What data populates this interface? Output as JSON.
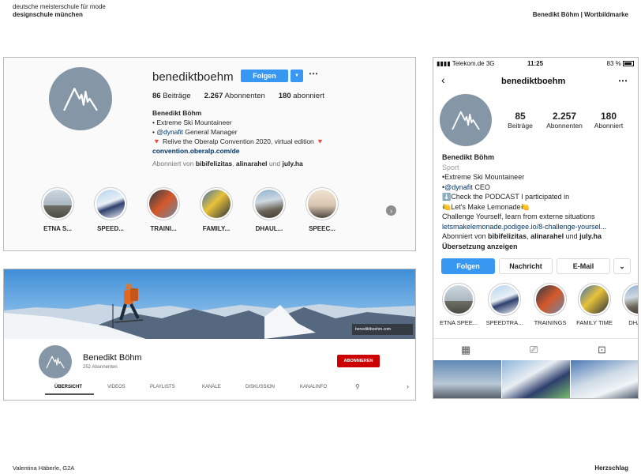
{
  "sheet": {
    "school_line1": "deutsche meisterschule für mode",
    "school_line2": "designschule münchen",
    "title": "Benedikt Böhm | Wortbildmarke",
    "author": "Valentina Häberle, G2A",
    "footer_title": "Herzschlag"
  },
  "colors": {
    "brand_circle": "#8597a6",
    "instagram_blue": "#3897f0",
    "youtube_red": "#cc0000"
  },
  "ig_desktop": {
    "username": "benediktboehm",
    "follow_label": "Folgen",
    "more_icon": "⋯",
    "posts": "86",
    "posts_label": "Beiträge",
    "followers": "2.267",
    "followers_label": "Abonnenten",
    "following": "180",
    "following_label": "abonniert",
    "bio_name": "Benedikt Böhm",
    "bio_line1": "• Extreme Ski Mountaineer",
    "bio_line2_pre": "• ",
    "bio_line2_tag": "@dynafit",
    "bio_line2_post": " General Manager",
    "bio_line3": "🔻 Relive the Oberalp Convention 2020, virtual edition 🔻",
    "bio_link": "convention.oberalp.com/de",
    "followed_pre": "Abonniert von ",
    "followed_1": "bibifelizitas",
    "followed_sep": ", ",
    "followed_2": "alinarahel",
    "followed_and": " und ",
    "followed_3": "july.ha",
    "highlights": [
      "ETNA S...",
      "SPEED...",
      "TRAINI...",
      "FAMILY...",
      "DHAUL...",
      "SPEEC..."
    ]
  },
  "youtube": {
    "watermark": "benediktboehm.com",
    "channel_name": "Benedikt Böhm",
    "subscribers": "252 Abonnenten",
    "subscribe_label": "ABONNIEREN",
    "tabs": [
      "ÜBERSICHT",
      "VIDEOS",
      "PLAYLISTS",
      "KANÄLE",
      "DISKUSSION",
      "KANALINFO"
    ],
    "search_icon": "⚲",
    "next_icon": "›"
  },
  "ig_mobile": {
    "carrier": "Telekom.de  3G",
    "time": "11:25",
    "battery": "83 %",
    "username": "benediktboehm",
    "posts": "85",
    "posts_label": "Beiträge",
    "followers": "2.257",
    "followers_label": "Abonnenten",
    "following": "180",
    "following_label": "Abonniert",
    "bio_name": "Benedikt Böhm",
    "bio_category": "Sport",
    "bio_line1": "•Extreme Ski Mountaineer",
    "bio_line2_pre": "•",
    "bio_line2_tag": "@dynafit",
    "bio_line2_post": " CEO",
    "bio_line3": "⬇️Check the PODCAST I participated in",
    "bio_line4": "🍋Let's Make Lemonade🍋",
    "bio_line5": "Challenge Yourself, learn from externe situations",
    "bio_link": "letsmakelemonade.podigee.io/8-challenge-yoursel...",
    "followed_pre": "Abonniert von ",
    "followed_1": "bibifelizitas",
    "followed_sep": ", ",
    "followed_2": "alinarahel",
    "followed_and": " und ",
    "followed_3": "july.ha",
    "translate": "Übersetzung anzeigen",
    "btn_follow": "Folgen",
    "btn_message": "Nachricht",
    "btn_email": "E-Mail",
    "btn_more": "⌄",
    "highlights": [
      "ETNA SPEE...",
      "SPEEDTRA...",
      "TRAININGS",
      "FAMILY TIME",
      "DHAUL"
    ]
  }
}
